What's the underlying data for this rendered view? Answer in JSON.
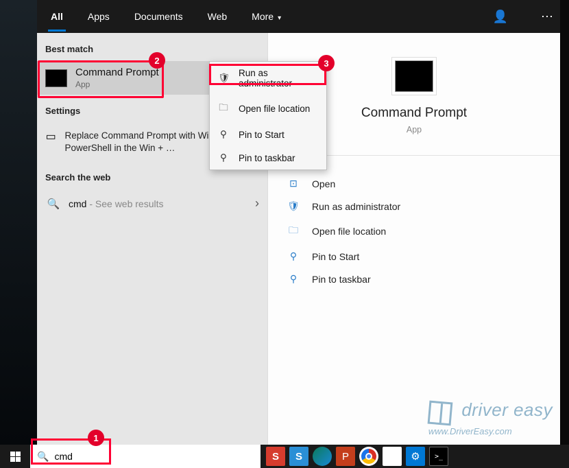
{
  "tabs": {
    "all": "All",
    "apps": "Apps",
    "documents": "Documents",
    "web": "Web",
    "more": "More"
  },
  "sections": {
    "best_match": "Best match",
    "settings": "Settings",
    "search_web": "Search the web"
  },
  "best_match": {
    "title": "Command Prompt",
    "subtitle": "App"
  },
  "settings_item": "Replace Command Prompt with Windows PowerShell in the Win + …",
  "web_result": {
    "term": "cmd",
    "suffix": " - See web results"
  },
  "context_menu": {
    "run_admin": "Run as administrator",
    "open_loc": "Open file location",
    "pin_start": "Pin to Start",
    "pin_taskbar": "Pin to taskbar"
  },
  "preview": {
    "title": "Command Prompt",
    "subtitle": "App"
  },
  "actions": {
    "open": "Open",
    "run_admin": "Run as administrator",
    "open_loc": "Open file location",
    "pin_start": "Pin to Start",
    "pin_taskbar": "Pin to taskbar"
  },
  "search": {
    "value": "cmd"
  },
  "annotations": {
    "b1": "1",
    "b2": "2",
    "b3": "3"
  },
  "watermark": {
    "title": "driver easy",
    "url": "www.DriverEasy.com"
  }
}
